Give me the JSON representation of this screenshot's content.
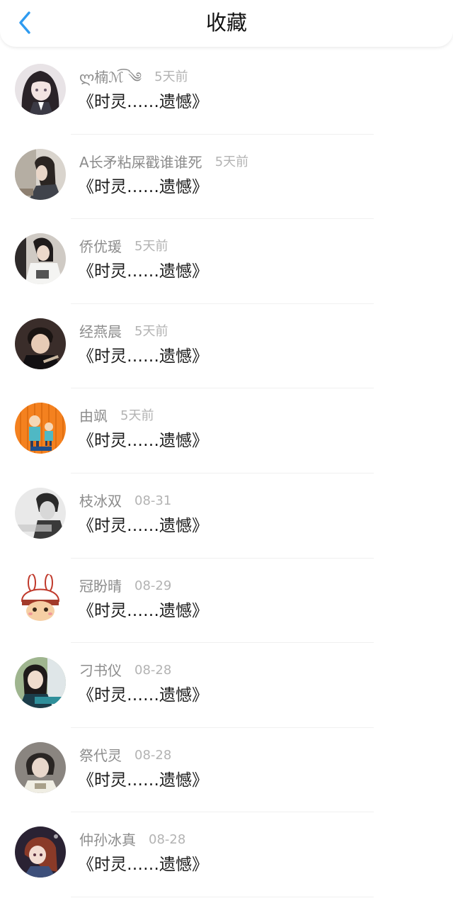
{
  "header": {
    "title": "收藏",
    "back_icon": "chevron-left-icon",
    "accent": "#2e9bf0"
  },
  "items": [
    {
      "user": "ლ楠ℳ͡ ༄",
      "time": "5天前",
      "title": "《时灵……遗憾》",
      "avatar_icon": "dark-hair-girl-avatar"
    },
    {
      "user": "A长矛粘屎戳谁谁死",
      "time": "5天前",
      "title": "《时灵……遗憾》",
      "avatar_icon": "girl-photo-avatar"
    },
    {
      "user": "侨优瑗",
      "time": "5天前",
      "title": "《时灵……遗憾》",
      "avatar_icon": "white-shirt-girl-avatar"
    },
    {
      "user": "经燕晨",
      "time": "5天前",
      "title": "《时灵……遗憾》",
      "avatar_icon": "boy-writing-avatar"
    },
    {
      "user": "由飒",
      "time": "5天前",
      "title": "《时灵……遗憾》",
      "avatar_icon": "cartoon-couple-avatar"
    },
    {
      "user": "枝冰双",
      "time": "08-31",
      "title": "《时灵……遗憾》",
      "avatar_icon": "grayscale-boy-avatar"
    },
    {
      "user": "冠盼晴",
      "time": "08-29",
      "title": "《时灵……遗憾》",
      "avatar_icon": "bunny-hat-cartoon-avatar"
    },
    {
      "user": "刁书仪",
      "time": "08-28",
      "title": "《时灵……遗憾》",
      "avatar_icon": "girl-outdoor-avatar"
    },
    {
      "user": "祭代灵",
      "time": "08-28",
      "title": "《时灵……遗憾》",
      "avatar_icon": "short-hair-girl-avatar"
    },
    {
      "user": "仲孙冰真",
      "time": "08-28",
      "title": "《时灵……遗憾》",
      "avatar_icon": "anime-girl-avatar"
    }
  ]
}
